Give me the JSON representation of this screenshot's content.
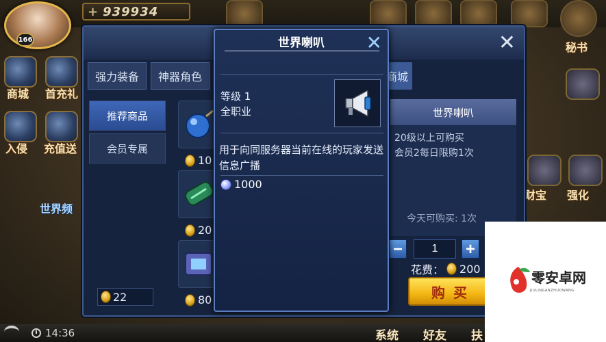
{
  "hud": {
    "player_level": "166",
    "power_value": "939934",
    "power_prefix": "+"
  },
  "side_menu": [
    {
      "label": "商城"
    },
    {
      "label": "首充礼"
    },
    {
      "label": "入侵"
    },
    {
      "label": "充值送"
    },
    {
      "label": "世界频"
    }
  ],
  "right_menu": [
    {
      "label": "秘书"
    },
    {
      "label": "财宝"
    },
    {
      "label": "强化"
    }
  ],
  "bottom_bar": {
    "time": "14:36",
    "system_label": "系统",
    "friends_label": "好友",
    "partial_label": "扶"
  },
  "shop": {
    "close_symbol": "✕",
    "tabs": [
      "强力装备",
      "神器角色"
    ],
    "tab_right_partial": "商城",
    "categories": [
      "推荐商品",
      "会员专属"
    ],
    "player_currency": "22",
    "items": [
      {
        "price": "10"
      },
      {
        "price": "20"
      },
      {
        "price": "80"
      }
    ],
    "detail": {
      "title": "世界喇叭",
      "requirement": "20级以上可购买",
      "vip_limit": "会员2每日限购1次",
      "daily_limit": "今天可购买: 1次",
      "quantity": "1",
      "minus": "−",
      "plus": "+",
      "cost_label": "花费：",
      "cost_value": "200",
      "buy_label": "购买"
    }
  },
  "tooltip": {
    "title": "世界喇叭",
    "close_symbol": "✕",
    "level_line": "等级 1",
    "class_line": "全职业",
    "description": "用于向同服务器当前在线的玩家发送信息广播",
    "gem_price": "1000"
  },
  "watermark": {
    "text": "零安卓网",
    "sub": "JIULINGANZHUOWANG"
  },
  "colors": {
    "panel_bg": "#16233f",
    "accent_blue": "#3f67b8",
    "buy_yellow": "#f3b614",
    "buy_text": "#a12b0c"
  }
}
